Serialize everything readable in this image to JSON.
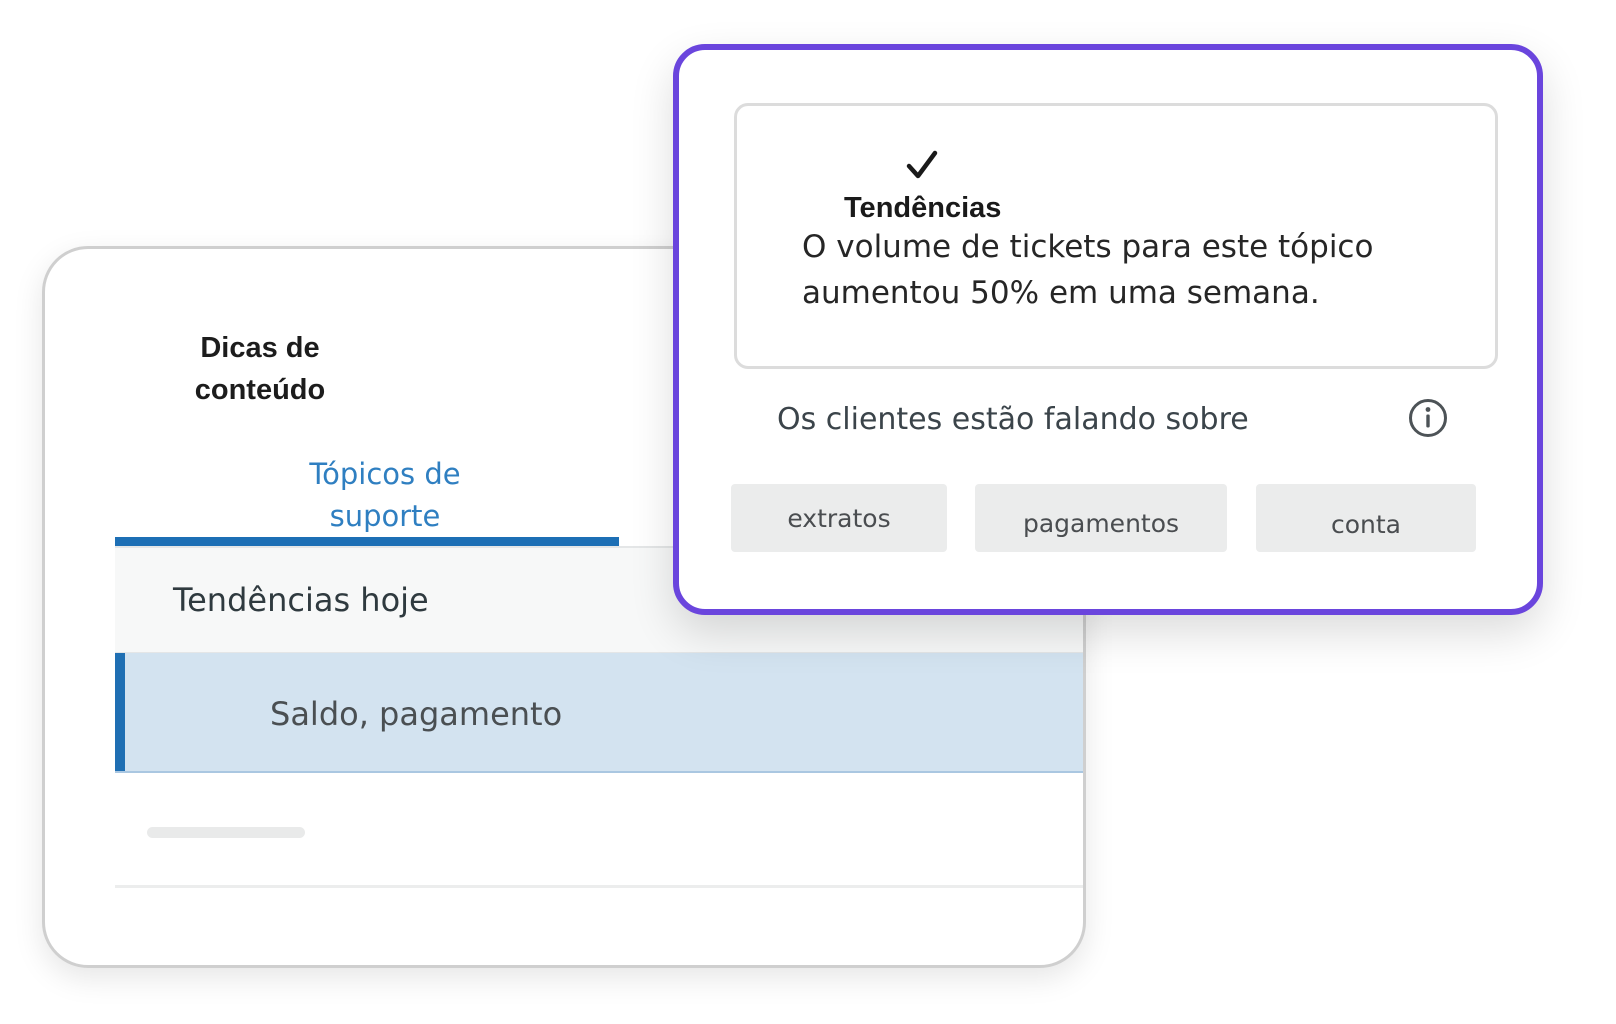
{
  "content_panel": {
    "title": "Dicas de conteúdo",
    "tab_label": "Tópicos de suporte",
    "section_header": "Tendências hoje",
    "selected_item": "Saldo, pagamento"
  },
  "insight_card": {
    "icon": "check-icon",
    "title": "Tendências",
    "message": "O volume de tickets para este tópico aumentou 50% em uma semana.",
    "topics_label": "Os clientes estão falando sobre",
    "info_icon": "info-icon",
    "tags": [
      "extratos",
      "pagamentos",
      "conta"
    ]
  },
  "colors": {
    "accent_purple": "#6a45dd",
    "tab_blue": "#2f7fc1",
    "selected_row_bg": "#d3e3f0",
    "selected_row_bar": "#1f6fb3",
    "tag_bg": "#ebecec"
  }
}
